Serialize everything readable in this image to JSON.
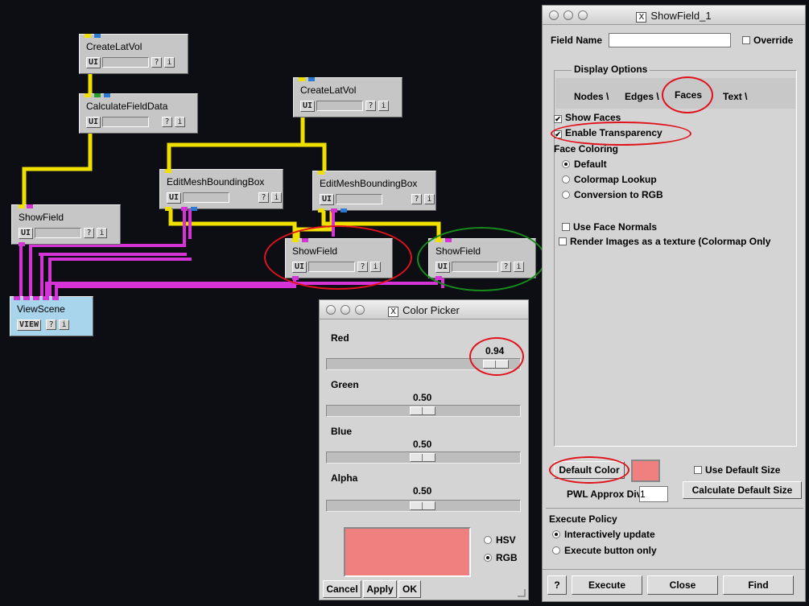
{
  "network": {
    "modules": [
      {
        "id": "cl1",
        "title": "CreateLatVol",
        "btn": "UI",
        "help": "?",
        "info": "i"
      },
      {
        "id": "cfd",
        "title": "CalculateFieldData",
        "btn": "UI",
        "help": "?",
        "info": "i"
      },
      {
        "id": "cl2",
        "title": "CreateLatVol",
        "btn": "UI",
        "help": "?",
        "info": "i"
      },
      {
        "id": "emb1",
        "title": "EditMeshBoundingBox",
        "btn": "UI",
        "help": "?",
        "info": "i"
      },
      {
        "id": "emb2",
        "title": "EditMeshBoundingBox",
        "btn": "UI",
        "help": "?",
        "info": "i"
      },
      {
        "id": "sf1",
        "title": "ShowField",
        "btn": "UI",
        "help": "?",
        "info": "i"
      },
      {
        "id": "sf2",
        "title": "ShowField",
        "btn": "UI",
        "help": "?",
        "info": "i"
      },
      {
        "id": "sf3",
        "title": "ShowField",
        "btn": "UI",
        "help": "?",
        "info": "i"
      },
      {
        "id": "vs",
        "title": "ViewScene",
        "btn": "VIEW",
        "help": "?",
        "info": "i"
      }
    ]
  },
  "color_picker": {
    "title": "Color Picker",
    "red_label": "Red",
    "red_value": "0.94",
    "red_level": 0.94,
    "green_label": "Green",
    "green_value": "0.50",
    "green_level": 0.5,
    "blue_label": "Blue",
    "blue_value": "0.50",
    "blue_level": 0.5,
    "alpha_label": "Alpha",
    "alpha_value": "0.50",
    "alpha_level": 0.5,
    "swatch_color": "#f08080",
    "hsv_label": "HSV",
    "rgb_label": "RGB",
    "selected_mode": "RGB",
    "cancel_label": "Cancel",
    "apply_label": "Apply",
    "ok_label": "OK"
  },
  "showfield": {
    "title": "ShowField_1",
    "field_name_label": "Field Name",
    "field_name_value": "",
    "override_label": "Override",
    "display_options_label": "Display Options",
    "tabs": [
      "Nodes",
      "Edges",
      "Faces",
      "Text"
    ],
    "active_tab": "Faces",
    "show_faces_label": "Show Faces",
    "enable_transparency_label": "Enable Transparency",
    "face_coloring_label": "Face Coloring",
    "coloring_options": [
      "Default",
      "Colormap Lookup",
      "Conversion to RGB"
    ],
    "selected_coloring": "Default",
    "use_face_normals_label": "Use Face Normals",
    "render_images_label": "Render Images as a texture (Colormap Only",
    "default_color_label": "Default Color",
    "default_color_swatch": "#f08080",
    "use_default_size_label": "Use Default Size",
    "pwl_label": "PWL Approx Div:",
    "pwl_value": "1",
    "calc_default_size_label": "Calculate Default Size",
    "execute_policy_label": "Execute Policy",
    "policy_options": [
      "Interactively update",
      "Execute button only"
    ],
    "selected_policy": "Interactively update",
    "help_label": "?",
    "execute_label": "Execute",
    "close_label": "Close",
    "find_label": "Find"
  },
  "colors": {
    "field_pipe": "#f0e000",
    "geom_pipe": "#d633d6",
    "highlight_red": "#e0121c",
    "highlight_green": "#178a1c",
    "viewscene_bg": "#a8d4ec"
  }
}
